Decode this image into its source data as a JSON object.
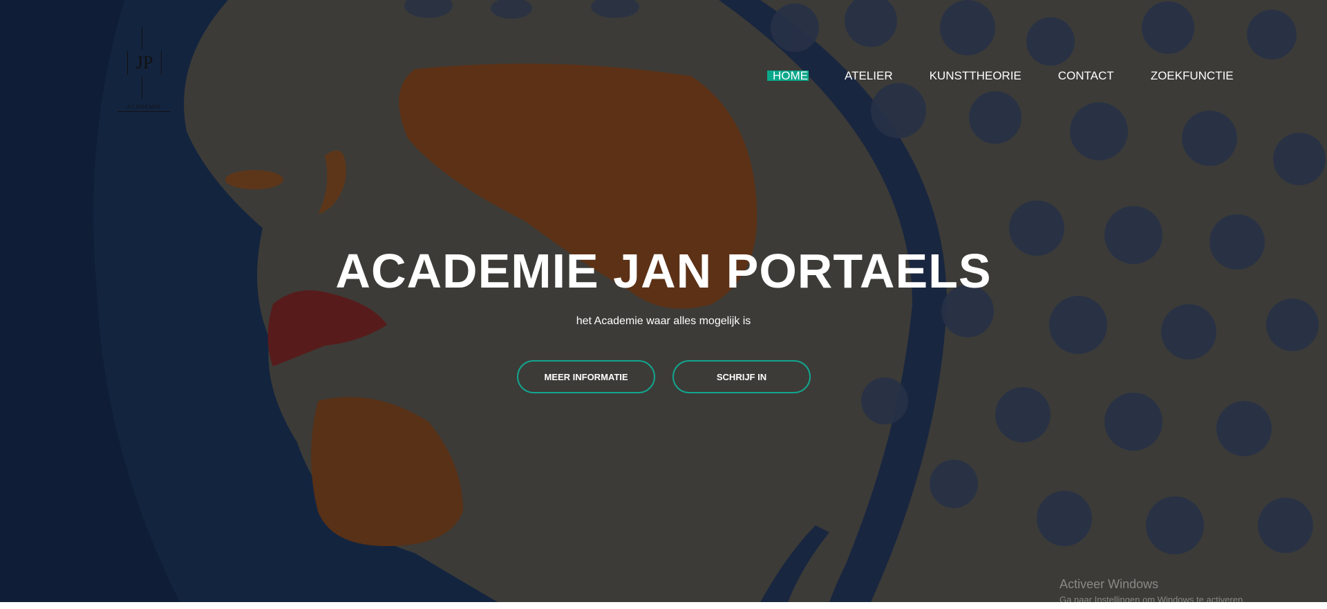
{
  "brand": {
    "logo_monogram": "JP",
    "logo_caption": "ACADEMIE"
  },
  "nav": {
    "items": [
      {
        "label": "HOME",
        "active": true
      },
      {
        "label": "ATELIER"
      },
      {
        "label": "KUNSTTHEORIE"
      },
      {
        "label": "CONTACT"
      },
      {
        "label": "ZOEKFUNCTIE"
      }
    ]
  },
  "hero": {
    "title": "ACADEMIE JAN PORTAELS",
    "subtitle": "het Academie waar alles mogelijk is",
    "buttons": [
      {
        "label": "MEER INFORMATIE"
      },
      {
        "label": "SCHRIJF IN"
      }
    ]
  },
  "watermark": {
    "line1": "Activeer Windows",
    "line2": "Ga naar Instellingen om Windows te activeren."
  },
  "colors": {
    "accent": "#0aa88b",
    "button_border": "#12a58f",
    "text": "#ffffff"
  }
}
